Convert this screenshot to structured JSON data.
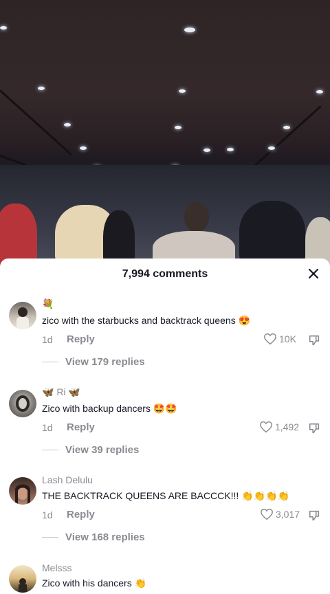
{
  "sheet": {
    "title": "7,994 comments"
  },
  "comments": [
    {
      "username": "💐",
      "text": "zico with the starbucks and backtrack queens 😍",
      "time": "1d",
      "reply_label": "Reply",
      "likes": "10K",
      "view_replies": "View 179 replies"
    },
    {
      "username": "🦋 Ri 🦋",
      "text": "Zico with backup dancers 🤩🤩",
      "time": "1d",
      "reply_label": "Reply",
      "likes": "1,492",
      "view_replies": "View 39 replies"
    },
    {
      "username": "Lash Delulu",
      "text": "THE BACKTRACK QUEENS ARE BACCCK!!! 👏👏👏👏",
      "time": "1d",
      "reply_label": "Reply",
      "likes": "3,017",
      "view_replies": "View 168 replies"
    },
    {
      "username": "Melsss",
      "text": "Zico with his dancers 👏"
    }
  ]
}
